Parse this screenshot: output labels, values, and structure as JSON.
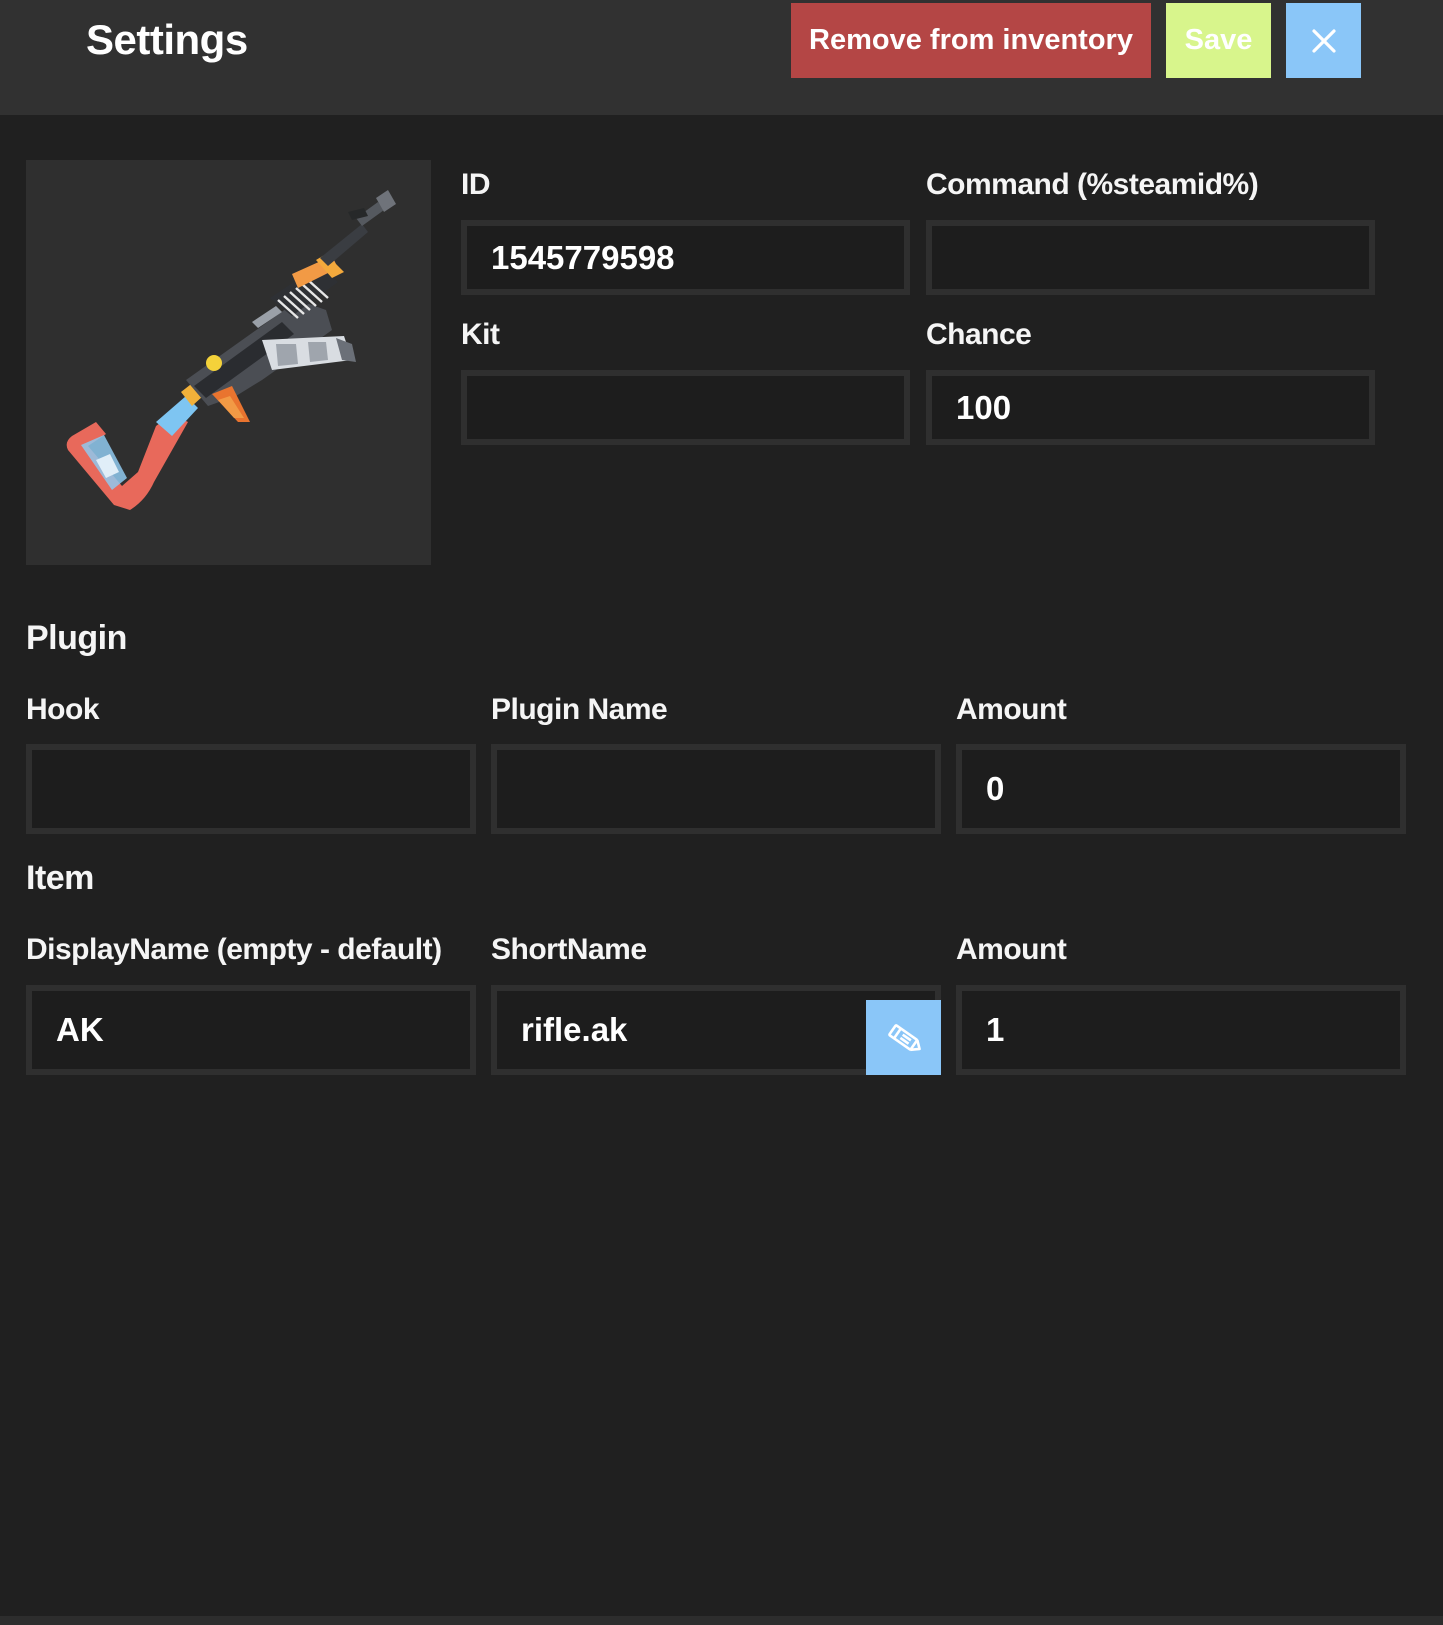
{
  "header": {
    "title": "Settings",
    "remove_label": "Remove from inventory",
    "save_label": "Save",
    "close_icon": "close-icon"
  },
  "colors": {
    "remove": "#b44645",
    "save": "#d8f58c",
    "close": "#8ac6f8",
    "edit": "#8ac6f8"
  },
  "general": {
    "id_label": "ID",
    "id_value": "1545779598",
    "command_label": "Command (%steamid%)",
    "command_value": "",
    "kit_label": "Kit",
    "kit_value": "",
    "chance_label": "Chance",
    "chance_value": "100"
  },
  "plugin": {
    "title": "Plugin",
    "hook_label": "Hook",
    "hook_value": "",
    "name_label": "Plugin Name",
    "name_value": "",
    "amount_label": "Amount",
    "amount_value": "0"
  },
  "item": {
    "title": "Item",
    "display_label": "DisplayName (empty - default)",
    "display_value": "AK",
    "short_label": "ShortName",
    "short_value": "rifle.ak",
    "amount_label": "Amount",
    "amount_value": "1",
    "edit_icon": "pencil-icon"
  }
}
